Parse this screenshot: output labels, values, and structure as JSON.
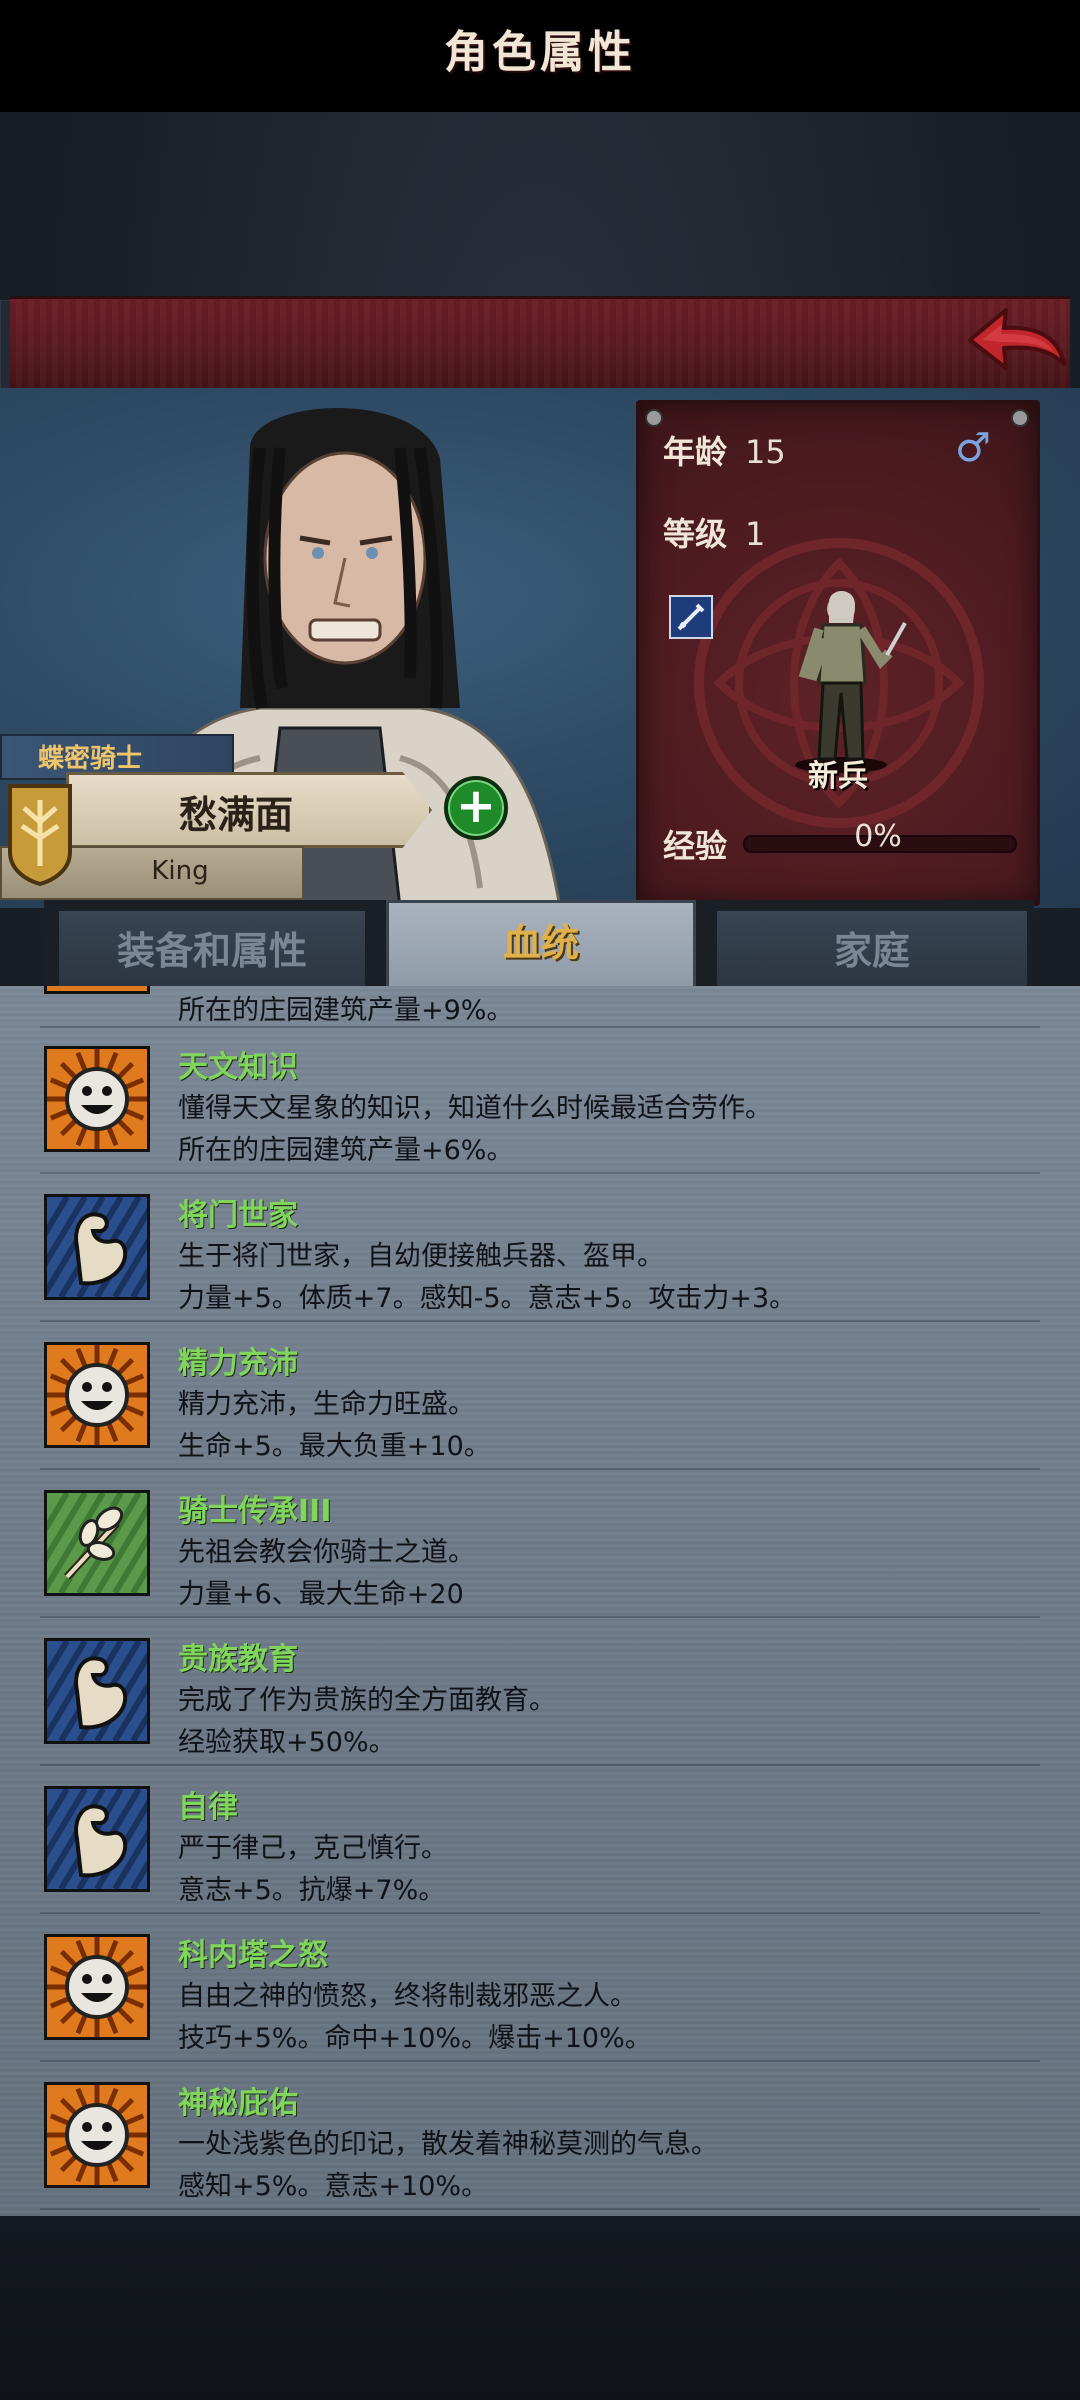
{
  "header": {
    "title": "角色属性"
  },
  "character": {
    "subtitle": "蝶密骑士",
    "name": "愁满面",
    "title": "King",
    "age_label": "年龄",
    "age": "15",
    "level_label": "等级",
    "level": "1",
    "class": "新兵",
    "exp_label": "经验",
    "exp_value": "0%",
    "exp_fraction": 0
  },
  "tabs": [
    {
      "label": "装备和属性",
      "active": false
    },
    {
      "label": "血统",
      "active": true
    },
    {
      "label": "家庭",
      "active": false
    }
  ],
  "partial_trait": {
    "effect": "所在的庄园建筑产量+9%。"
  },
  "traits": [
    {
      "icon": "smiley-icon",
      "name": "天文知识",
      "desc": "懂得天文星象的知识，知道什么时候最适合劳作。",
      "effect": "所在的庄园建筑产量+6%。"
    },
    {
      "icon": "muscle-arm-icon",
      "name": "将门世家",
      "desc": "生于将门世家，自幼便接触兵器、盔甲。",
      "effect": "力量+5。体质+7。感知-5。意志+5。攻击力+3。"
    },
    {
      "icon": "smiley-icon",
      "name": "精力充沛",
      "desc": "精力充沛，生命力旺盛。",
      "effect": "生命+5。最大负重+10。"
    },
    {
      "icon": "leaf-branch-icon",
      "name": "骑士传承III",
      "desc": "先祖会教会你骑士之道。",
      "effect": "力量+6、最大生命+20"
    },
    {
      "icon": "muscle-arm-icon",
      "name": "贵族教育",
      "desc": "完成了作为贵族的全方面教育。",
      "effect": "经验获取+50%。"
    },
    {
      "icon": "muscle-arm-icon",
      "name": "自律",
      "desc": "严于律己，克己慎行。",
      "effect": "意志+5。抗爆+7%。"
    },
    {
      "icon": "smiley-icon",
      "name": "科内塔之怒",
      "desc": "自由之神的愤怒，终将制裁邪恶之人。",
      "effect": "技巧+5%。命中+10%。爆击+10%。"
    },
    {
      "icon": "smiley-icon",
      "name": "神秘庇佑",
      "desc": "一处浅紫色的印记，散发着神秘莫测的气息。",
      "effect": "感知+5%。意志+10%。"
    }
  ],
  "colors": {
    "banner": "#6c1f26",
    "trait_name": "#7fd65a",
    "active_tab_text": "#e0b04a",
    "plus_button": "#1f8a2a"
  }
}
